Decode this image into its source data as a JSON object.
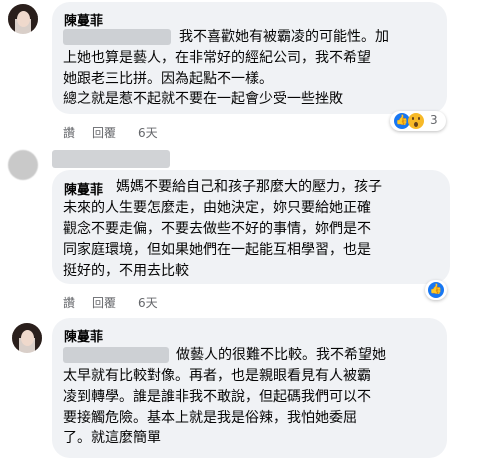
{
  "comments": [
    {
      "author": "陳蔓菲",
      "lines": [
        "我不喜歡她有被霸凌的可能性。加",
        "上她也算是藝人，在非常好的經紀公司，我不希望",
        "她跟老三比拼。因為起點不一樣。",
        "總之就是惹不起就不要在一起會少受一些挫敗"
      ],
      "like_label": "讚",
      "reply_label": "回覆",
      "time": "6天",
      "reaction_count": "3"
    },
    {
      "author": "陳蔓菲",
      "lines": [
        "媽媽不要給自己和孩子那麼大的壓力，孩子",
        "未來的人生要怎麼走，由她決定，妳只要給她正確",
        "觀念不要走偏，不要去做些不好的事情，妳們是不",
        "同家庭環境，但如果她們在一起能互相學習，也是",
        "挺好的，不用去比較"
      ],
      "like_label": "讚",
      "reply_label": "回覆",
      "time": "6天"
    },
    {
      "author": "陳蔓菲",
      "lines": [
        "做藝人的很難不比較。我不希望她",
        "太早就有比較對像。再者，也是親眼看見有人被霸",
        "凌到轉學。誰是誰非我不敢說，但起碼我們可以不",
        "要接觸危險。基本上就是我是俗辣，我怕她委屈",
        "了。就這麼簡單"
      ]
    }
  ],
  "icons": {
    "like": "like-reaction-icon",
    "wow": "wow-reaction-icon"
  },
  "colors": {
    "bubble": "#f0f2f5",
    "meta": "#65676b",
    "like": "#1877f2",
    "wow": "#f7b928"
  }
}
